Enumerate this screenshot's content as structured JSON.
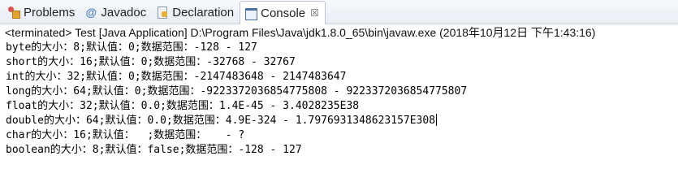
{
  "tabs": [
    {
      "label": "Problems",
      "icon": "problems-icon"
    },
    {
      "label": "Javadoc",
      "icon": "javadoc-icon"
    },
    {
      "label": "Declaration",
      "icon": "declaration-icon"
    },
    {
      "label": "Console",
      "icon": "console-icon",
      "close": "☒"
    }
  ],
  "console": {
    "status": "<terminated> Test [Java Application] D:\\Program Files\\Java\\jdk1.8.0_65\\bin\\javaw.exe (2018年10月12日 下午1:43:16)",
    "lines": [
      "byte的大小：8;默认值：0;数据范围：-128 - 127",
      "short的大小：16;默认值：0;数据范围：-32768 - 32767",
      "int的大小：32;默认值：0;数据范围：-2147483648 - 2147483647",
      "long的大小：64;默认值：0;数据范围：-9223372036854775808 - 9223372036854775807",
      "float的大小：32;默认值：0.0;数据范围：1.4E-45 - 3.4028235E38",
      "double的大小：64;默认值：0.0;数据范围：4.9E-324 - 1.7976931348623157E308",
      "char的大小：16;默认值：  ;数据范围：   - ?",
      "boolean的大小：8;默认值：false;数据范围：-128 - 127"
    ]
  }
}
